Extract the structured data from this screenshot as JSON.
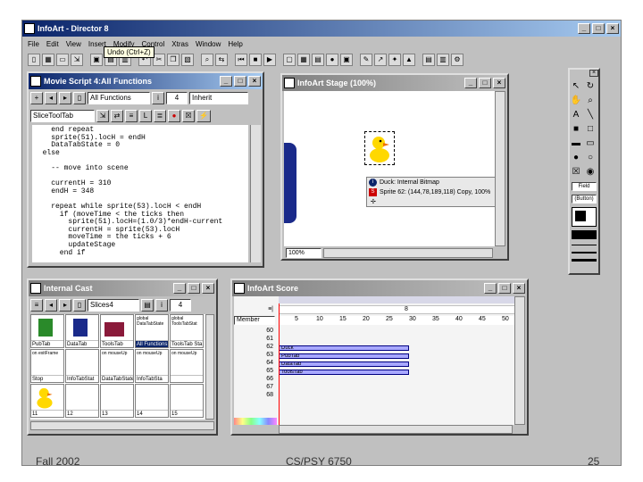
{
  "app": {
    "title": "InfoArt - Director 8",
    "menu": [
      "File",
      "Edit",
      "View",
      "Insert",
      "Modify",
      "Control",
      "Xtras",
      "Window",
      "Help"
    ],
    "tooltip": "Undo (Ctrl+Z)"
  },
  "script_window": {
    "title": "Movie Script 4:All Functions",
    "handler_dropdown": "All Functions",
    "number_field": "4",
    "mode_dropdown": "Inherit",
    "member_dropdown": "SliceToolTab",
    "code_lines": [
      "    end repeat",
      "    sprite(51).locH = endH",
      "    DataTabState = 0",
      "  else",
      "",
      "    -- move into scene",
      "",
      "    currentH = 310",
      "    endH = 348",
      "",
      "    repeat while sprite(53).locH < endH",
      "      if (moveTime < the ticks then",
      "        sprite(51).locH=(1.0/3)*endH-current",
      "        currentH = sprite(53).locH",
      "        moveTime = the ticks + 6",
      "        updateStage",
      "      end if"
    ]
  },
  "stage_window": {
    "title": "InfoArt Stage (100%)",
    "popup_line1": "Duck: Internal Bitmap",
    "popup_line2": "Sprite 62: (144,78,189,118) Copy, 100%",
    "zoom": "100%"
  },
  "cast_window": {
    "title": "Internal Cast",
    "member_dropdown": "Slices4",
    "number_field": "4",
    "cells": [
      {
        "label": "PubTab"
      },
      {
        "label": "DataTab"
      },
      {
        "label": "ToolsTab"
      },
      {
        "label": "All Functions"
      },
      {
        "label": "ToolsTab Sta"
      },
      {
        "label": "Stop"
      },
      {
        "label": "InfoTabStat"
      },
      {
        "label": "DataTabState"
      },
      {
        "label": "InfoTabSta"
      },
      {
        "label": ""
      },
      {
        "label": ""
      },
      {
        "label": ""
      },
      {
        "label": ""
      },
      {
        "label": ""
      },
      {
        "label": ""
      }
    ],
    "text_cells": [
      {
        "text": "global DataTabState"
      },
      {
        "text": "global ToolsTabStat"
      },
      {
        "text": "on exitFrame"
      },
      {
        "text": "on mouseUp"
      },
      {
        "text": "on mouseUp"
      },
      {
        "text": "on mouseUp"
      }
    ],
    "numbers": [
      "11",
      "12",
      "13",
      "14",
      "15"
    ]
  },
  "score_window": {
    "title": "InfoArt Score",
    "frame_field": "8",
    "channel_dropdown": "Member",
    "ruler": [
      "5",
      "10",
      "15",
      "20",
      "25",
      "30",
      "35",
      "40",
      "45",
      "50"
    ],
    "channels": [
      "60",
      "61",
      "62",
      "63",
      "64",
      "65",
      "66",
      "67",
      "68"
    ],
    "sprites": [
      {
        "label": "Duck"
      },
      {
        "label": "PubTab"
      },
      {
        "label": "DataTab"
      },
      {
        "label": "ToolsTab"
      }
    ]
  },
  "tool_palette": {
    "field1": "Field",
    "field2": "(Button)"
  },
  "footer": {
    "left": "Fall 2002",
    "center": "CS/PSY 6750",
    "right": "25"
  },
  "colors": {
    "active_title": "#0a246a",
    "navy_shape": "#1a2a8a",
    "sprite_bar": "#a8a8ff",
    "playhead": "#ff0000"
  }
}
